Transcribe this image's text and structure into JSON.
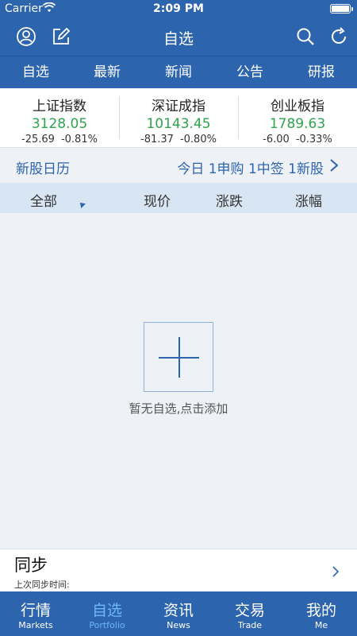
{
  "status_bar": {
    "carrier": "Carrier",
    "time": "2:09 PM"
  },
  "nav": {
    "title": "自选",
    "icons": [
      "user-icon",
      "edit-icon",
      "search-icon",
      "refresh-icon"
    ]
  },
  "tabs": [
    "自选",
    "最新",
    "新闻",
    "公告",
    "研报"
  ],
  "indices": [
    {
      "name": "上证指数",
      "price": "3128.05",
      "change": "-25.69",
      "percent": "-0.81%"
    },
    {
      "name": "深证成指",
      "price": "10143.45",
      "change": "-81.37",
      "percent": "-0.80%"
    },
    {
      "name": "创业板指",
      "price": "1789.63",
      "change": "-6.00",
      "percent": "-0.33%"
    }
  ],
  "ipo": {
    "label": "新股日历",
    "summary": "今日 1申购 1中签 1新股"
  },
  "columns": {
    "all": "全部",
    "price": "现价",
    "change": "涨跌",
    "percent": "涨幅"
  },
  "empty": {
    "text": "暂无自选,点击添加"
  },
  "sync": {
    "title": "同步",
    "last_sync": "上次同步时间:"
  },
  "tabbar": [
    {
      "cn": "行情",
      "en": "Markets"
    },
    {
      "cn": "自选",
      "en": "Portfolio"
    },
    {
      "cn": "资讯",
      "en": "News"
    },
    {
      "cn": "交易",
      "en": "Trade"
    },
    {
      "cn": "我的",
      "en": "Me"
    }
  ],
  "colors": {
    "brand": "#2d64ae",
    "up_green": "#2ea44f",
    "active_tab": "#6fb6f4",
    "header_row": "#d8e5f3"
  }
}
